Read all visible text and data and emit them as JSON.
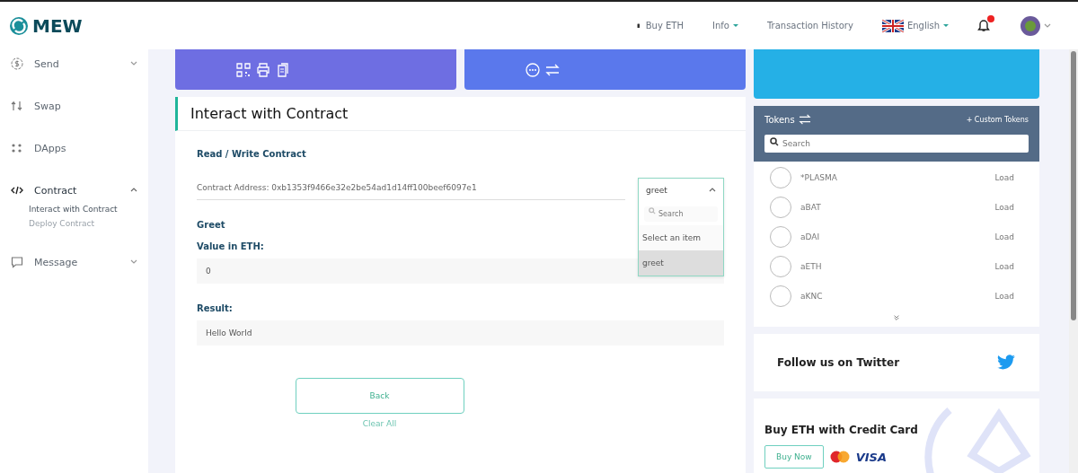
{
  "header": {
    "logo": "MEW",
    "nav": [
      {
        "kind": "buy",
        "label": "Buy ETH"
      },
      {
        "kind": "dropdown",
        "label": "Info"
      },
      {
        "kind": "link",
        "label": "Transaction History"
      },
      {
        "kind": "language",
        "label": "English"
      }
    ],
    "notifications": {
      "unread": true
    }
  },
  "sidebar": {
    "items": [
      {
        "label": "Send",
        "expanded": false
      },
      {
        "label": "Swap"
      },
      {
        "label": "DApps"
      },
      {
        "label": "Contract",
        "expanded": true,
        "children": [
          {
            "label": "Interact with Contract",
            "selected": true
          },
          {
            "label": "Deploy Contract",
            "selected": false
          }
        ]
      },
      {
        "label": "Message",
        "expanded": false
      }
    ]
  },
  "panel": {
    "title": "Interact with Contract",
    "section": "Read / Write Contract",
    "contract_address": "Contract Address: 0xb1353f9466e32e2be54ad1d14ff100beef6097e1",
    "method_select": {
      "value": "greet",
      "expanded": true,
      "search_placeholder": "Search",
      "options": [
        {
          "label": "Select an item",
          "selected": false
        },
        {
          "label": "greet",
          "selected": true
        }
      ]
    },
    "method_name": "Greet",
    "fields": [
      {
        "label": "Value in ETH:",
        "value": "0"
      },
      {
        "label": "Result:",
        "value": "Hello World"
      }
    ],
    "buttons": {
      "primary": "Back",
      "secondary": "Clear All"
    }
  },
  "tokens": {
    "title": "Tokens",
    "custom": "+ Custom Tokens",
    "search_placeholder": "Search",
    "rows": [
      {
        "name": "*PLASMA",
        "action": "Load"
      },
      {
        "name": "aBAT",
        "action": "Load"
      },
      {
        "name": "aDAI",
        "action": "Load"
      },
      {
        "name": "aETH",
        "action": "Load"
      },
      {
        "name": "aKNC",
        "action": "Load"
      }
    ]
  },
  "twitter": {
    "text": "Follow us on Twitter"
  },
  "buy_card": {
    "title": "Buy ETH with Credit Card",
    "button": "Buy Now",
    "visa": "VISA"
  }
}
